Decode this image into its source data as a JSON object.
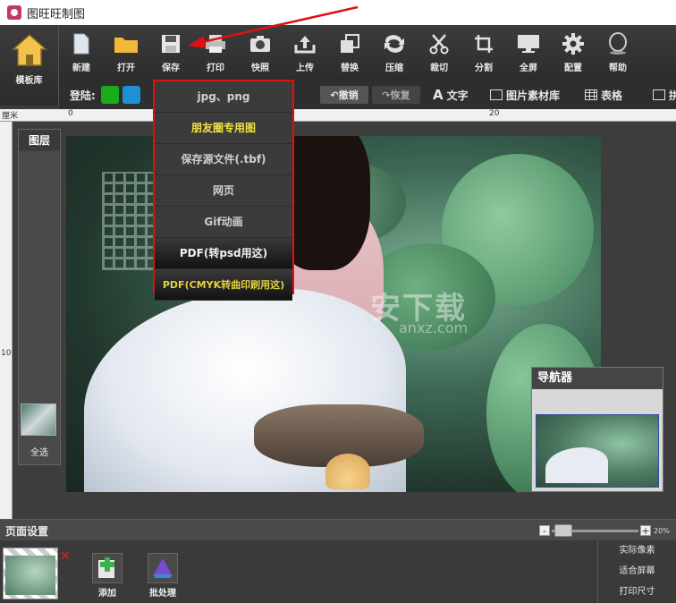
{
  "window": {
    "title": "图旺旺制图"
  },
  "toolbar": {
    "template": "模板库",
    "items": [
      {
        "label": "新建",
        "icon": "new-file-icon"
      },
      {
        "label": "打开",
        "icon": "folder-icon"
      },
      {
        "label": "保存",
        "icon": "save-icon"
      },
      {
        "label": "打印",
        "icon": "printer-icon"
      },
      {
        "label": "快照",
        "icon": "camera-icon"
      },
      {
        "label": "上传",
        "icon": "upload-icon"
      },
      {
        "label": "替换",
        "icon": "replace-icon"
      },
      {
        "label": "压缩",
        "icon": "compress-icon"
      },
      {
        "label": "裁切",
        "icon": "scissors-icon"
      },
      {
        "label": "分割",
        "icon": "crop-icon"
      },
      {
        "label": "全屏",
        "icon": "monitor-icon"
      },
      {
        "label": "配置",
        "icon": "gear-icon"
      },
      {
        "label": "帮助",
        "icon": "help-icon"
      }
    ]
  },
  "subbar": {
    "login": "登陆:",
    "undo": "撤销",
    "redo": "恢复",
    "text": "文字",
    "material": "图片素材库",
    "table": "表格",
    "collage": "拼"
  },
  "ruler": {
    "unit": "厘米",
    "labels": [
      "0",
      "10",
      "20"
    ],
    "v_label": "10"
  },
  "layers": {
    "title": "图层",
    "select_all": "全选"
  },
  "save_menu": {
    "items": [
      "jpg、png",
      "朋友圈专用图",
      "保存源文件(.tbf)",
      "网页",
      "Gif动画",
      "PDF(转psd用这)",
      "PDF(CMYK转曲印刷用这)"
    ]
  },
  "watermark": {
    "main": "安下载",
    "sub": "anxz.com"
  },
  "navigator": {
    "title": "导航器"
  },
  "page_settings": {
    "label": "页面设置",
    "zoom": "20%",
    "zoom_level_percent": 20
  },
  "bottom": {
    "add": "添加",
    "batch": "批处理",
    "close": "✕",
    "options": [
      "实际像素",
      "适合屏幕",
      "打印尺寸"
    ]
  },
  "colors": {
    "highlight_red": "#e01010",
    "menu_yellow": "#f2e33c",
    "toolbar_bg": "#2e2e2e"
  }
}
